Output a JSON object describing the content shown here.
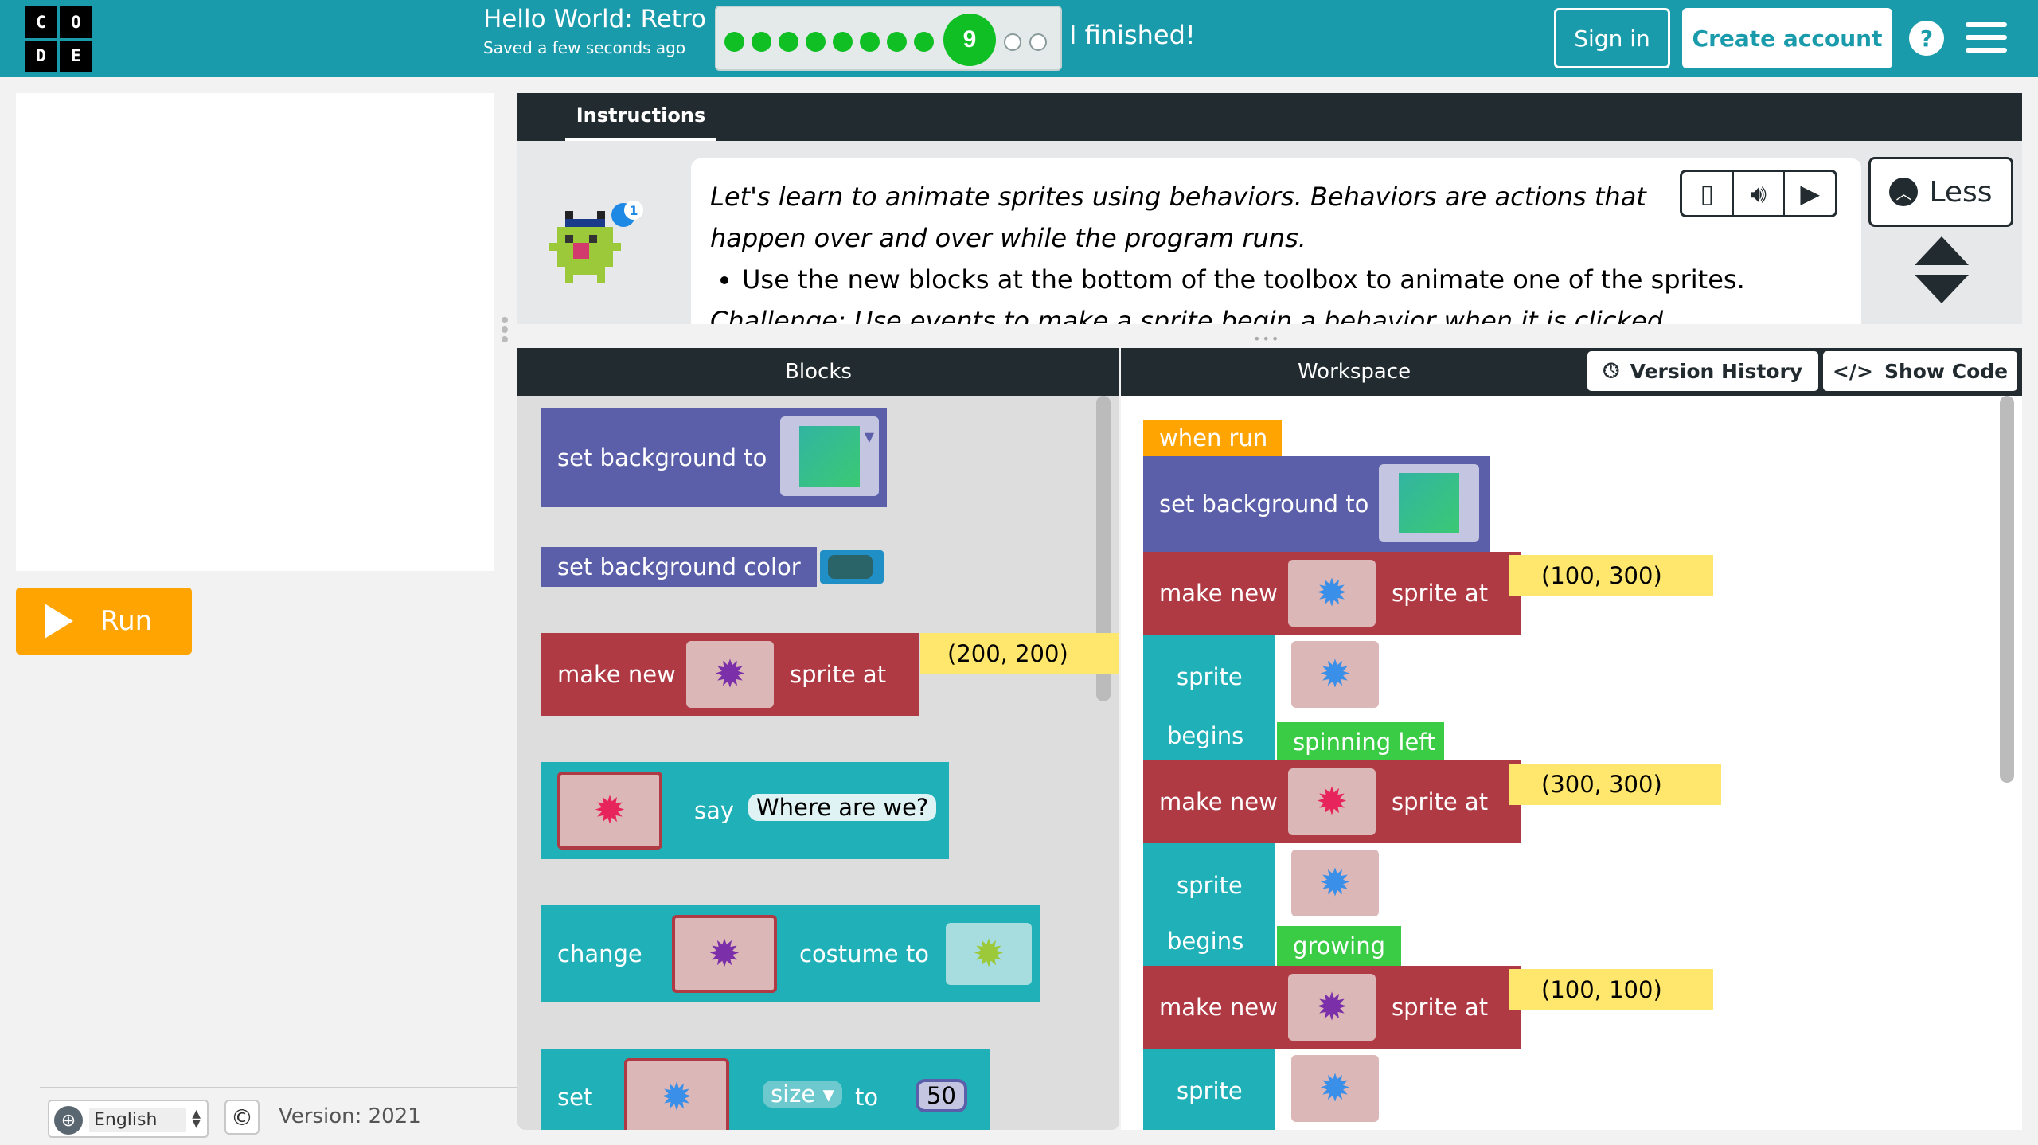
{
  "header": {
    "logo": [
      "C",
      "O",
      "D",
      "E"
    ],
    "project_title": "Hello World: Retro",
    "saved": "Saved a few seconds ago",
    "current_level": "9",
    "finished": "I finished!",
    "sign_in": "Sign in",
    "create_account": "Create account",
    "help": "?"
  },
  "stage": {
    "run": "Run"
  },
  "footer": {
    "language": "English",
    "copyright": "©",
    "version": "Version: 2021"
  },
  "instructions": {
    "tab": "Instructions",
    "text": "Let's learn to animate sprites using behaviors. Behaviors are actions that happen over and over while the program runs.",
    "bullet": "Use the new blocks at the bottom of the toolbox to animate one of the sprites.",
    "challenge_partial": "Challenge: Use events to make a sprite begin a behavior when it is clicked.",
    "hint_badge": "1",
    "less": "Less"
  },
  "panes": {
    "blocks": "Blocks",
    "workspace": "Workspace",
    "version_history": "Version History",
    "show_code": "Show Code"
  },
  "toolbox": {
    "set_bg": "set background to",
    "set_bg_color": "set background color",
    "make_new": "make new",
    "sprite_at": "sprite at",
    "coord": "(200, 200)",
    "say": "say",
    "say_text": "Where are we?",
    "change": "change",
    "costume_to": "costume to",
    "set": "set",
    "size": "size",
    "to": "to",
    "size_val": "50"
  },
  "workspace": {
    "when_run": "when run",
    "set_bg": "set background to",
    "make_new": "make new",
    "sprite_at": "sprite at",
    "sprite": "sprite",
    "begins": "begins",
    "coord1": "(100, 300)",
    "behavior1": "spinning left",
    "coord2": "(300, 300)",
    "behavior2": "growing",
    "coord3": "(100, 100)"
  },
  "colors": {
    "header": "#1a9bab",
    "progress_green": "#0fbf24",
    "run_button": "#ffa400",
    "dark_bar": "#222b2f",
    "block_purple": "#5b5fa9",
    "block_red": "#b03a44",
    "block_teal": "#1fb0b8",
    "block_orange": "#ffa400",
    "block_green": "#3acc45",
    "block_yellow": "#ffe76e"
  }
}
